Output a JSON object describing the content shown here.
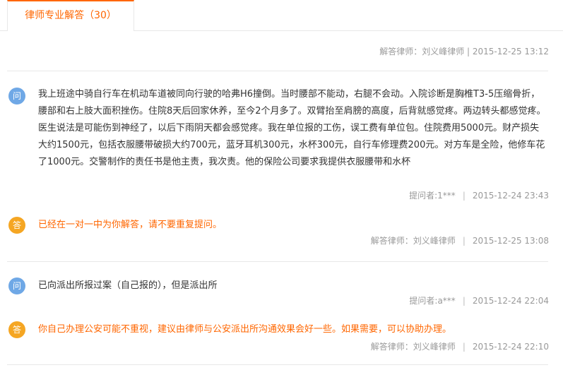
{
  "tab": {
    "label": "律师专业解答（30）"
  },
  "previous_item": {
    "meta": "解答律师：刘义峰律师  |  2015-12-25 13:12"
  },
  "badges": {
    "question": "问",
    "answer": "答"
  },
  "threads": [
    {
      "question": {
        "text": "我上班途中骑自行车在机动车道被同向行驶的哈弗H6撞倒。当时腰部不能动，右腿不会动。入院诊断是胸椎T3-5压缩骨折，腰部和右上肢大面积挫伤。住院8天后回家休养，至今2个月多了。双臂抬至肩膀的高度，后背就感觉疼。两边转头都感觉疼。医生说法是可能伤到神经了，以后下雨阴天都会感觉疼。我在单位报的工伤，误工费有单位包。住院费用5000元。财产损失大约1500元，包括衣服腰带破损大约700元，蓝牙耳机300元，水杯300元，自行车修理费200元。对方车是全险，他修车花了1000元。交警制作的责任书是他主责，我次责。他的保险公司要求我提供衣服腰带和水杯",
        "author": "提问者:1***",
        "time": "2015-12-24 23:43"
      },
      "answer": {
        "text": "已经在一对一中为你解答，请不要重复提问。",
        "author": "解答律师：刘义峰律师",
        "time": "2015-12-25 13:08"
      }
    },
    {
      "question": {
        "text": "已向派出所报过案（自己报的），但是派出所",
        "author": "提问者:a***",
        "time": "2015-12-24 22:04"
      },
      "answer": {
        "text": "你自己办理公安可能不重视，建议由律师与公安派出所沟通效果会好一些。如果需要，可以协助办理。",
        "author": "解答律师：刘义峰律师",
        "time": "2015-12-24 22:10"
      }
    }
  ]
}
